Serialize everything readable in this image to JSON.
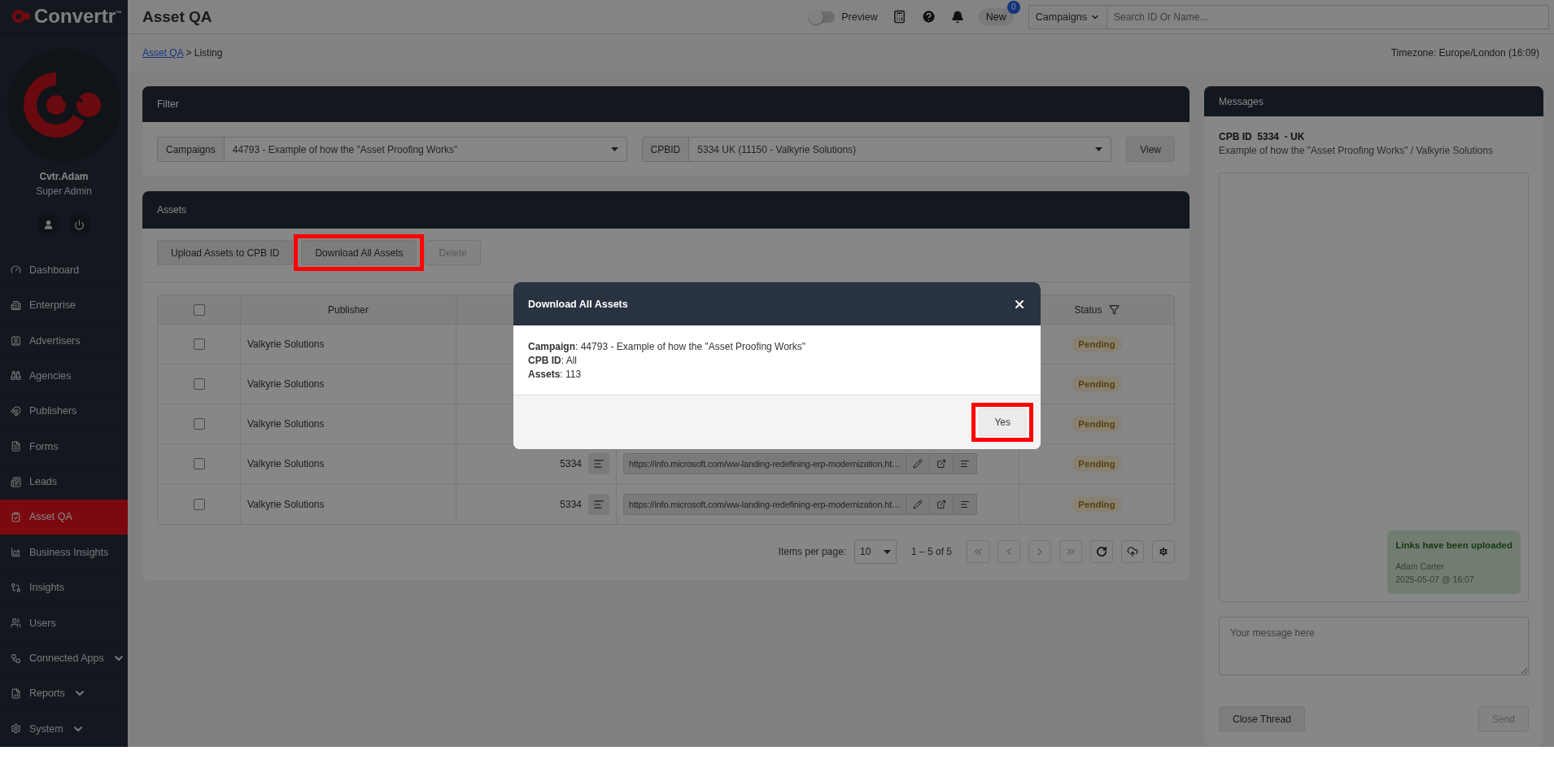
{
  "brand": {
    "name": "Convertr",
    "mark": "™"
  },
  "user": {
    "name": "Cvtr.Adam",
    "role": "Super Admin"
  },
  "nav": [
    {
      "label": "Dashboard",
      "kind": "dashboard",
      "selected": false,
      "expandable": false
    },
    {
      "label": "Enterprise",
      "kind": "enterprise",
      "selected": false,
      "expandable": false
    },
    {
      "label": "Advertisers",
      "kind": "advertisers",
      "selected": false,
      "expandable": false
    },
    {
      "label": "Agencies",
      "kind": "agencies",
      "selected": false,
      "expandable": false
    },
    {
      "label": "Publishers",
      "kind": "publishers",
      "selected": false,
      "expandable": false
    },
    {
      "label": "Forms",
      "kind": "forms",
      "selected": false,
      "expandable": false
    },
    {
      "label": "Leads",
      "kind": "leads",
      "selected": false,
      "expandable": false
    },
    {
      "label": "Asset QA",
      "kind": "assetqa",
      "selected": true,
      "expandable": false
    },
    {
      "label": "Business Insights",
      "kind": "business",
      "selected": false,
      "expandable": false
    },
    {
      "label": "Insights",
      "kind": "insights",
      "selected": false,
      "expandable": false
    },
    {
      "label": "Users",
      "kind": "users",
      "selected": false,
      "expandable": false
    },
    {
      "label": "Connected Apps",
      "kind": "apps",
      "selected": false,
      "expandable": true
    },
    {
      "label": "Reports",
      "kind": "reports",
      "selected": false,
      "expandable": true
    },
    {
      "label": "System",
      "kind": "system",
      "selected": false,
      "expandable": true
    }
  ],
  "topbar": {
    "title": "Asset QA",
    "preview": {
      "label": "Preview",
      "on": false
    },
    "new_button": {
      "label": "New",
      "badge": "0"
    },
    "scope": "Campaigns",
    "search": {
      "placeholder": "Search ID Or Name..."
    }
  },
  "breadcrumb": {
    "link": "Asset QA",
    "separator": ">",
    "current": "Listing"
  },
  "timezone": "Timezone: Europe/London (16:09)",
  "filter": {
    "title": "Filter",
    "fields": [
      {
        "label": "Campaigns",
        "value": "44793 - Example of how the \"Asset Proofing Works\""
      },
      {
        "label": "CPBID",
        "value": "5334 UK (11150 - Valkyrie Solutions)"
      }
    ],
    "button": "View"
  },
  "assets": {
    "title": "Assets",
    "actions": [
      {
        "label": "Upload Assets to CPB ID",
        "disabled": false,
        "highlighted": false
      },
      {
        "label": "Download All Assets",
        "disabled": false,
        "highlighted": true
      },
      {
        "label": "Delete",
        "disabled": true,
        "highlighted": false
      }
    ],
    "table": {
      "header": {
        "checked": false,
        "publisher": "Publisher",
        "status": "Status"
      },
      "rows": [
        {
          "checked": false,
          "publisher": "Valkyrie Solutions",
          "status": "Pending"
        },
        {
          "checked": false,
          "publisher": "Valkyrie Solutions",
          "status": "Pending"
        },
        {
          "checked": false,
          "publisher": "Valkyrie Solutions",
          "status": "Pending"
        },
        {
          "checked": false,
          "publisher": "Valkyrie Solutions",
          "cpb_id": "5334",
          "url": "https://info.microsoft.com/ww-landing-redefining-erp-modernization.ht…",
          "status": "Pending"
        },
        {
          "checked": false,
          "publisher": "Valkyrie Solutions",
          "cpb_id": "5334",
          "url": "https://info.microsoft.com/ww-landing-redefining-erp-modernization.ht…",
          "status": "Pending"
        }
      ]
    },
    "pagination": {
      "label": "Items per page:",
      "per_page": "10",
      "range": "1 – 5 of 5",
      "nav": [
        {
          "kind": "first",
          "disabled": true
        },
        {
          "kind": "prev",
          "disabled": true
        },
        {
          "kind": "next",
          "disabled": true
        },
        {
          "kind": "last",
          "disabled": true
        }
      ]
    }
  },
  "messages": {
    "title": "Messages",
    "heading": "CPB ID  5334  - UK",
    "subtitle": "Example of how the \"Asset Proofing Works\" / Valkyrie Solutions",
    "thread": [
      {
        "text": "Links have been uploaded",
        "author": "Adam Carter",
        "time": "2025-05-07 @ 16:07"
      }
    ],
    "input": {
      "placeholder": "Your message here"
    },
    "close_button": "Close Thread",
    "send": {
      "label": "Send",
      "disabled": true
    }
  },
  "modal": {
    "title": "Download All Assets",
    "lines": [
      "**Campaign**: 44793 - Example of how the \"Asset Proofing Works\"",
      "**CPB ID**: All",
      "**Assets**: 113"
    ],
    "confirm": {
      "label": "Yes",
      "highlighted": true
    }
  }
}
